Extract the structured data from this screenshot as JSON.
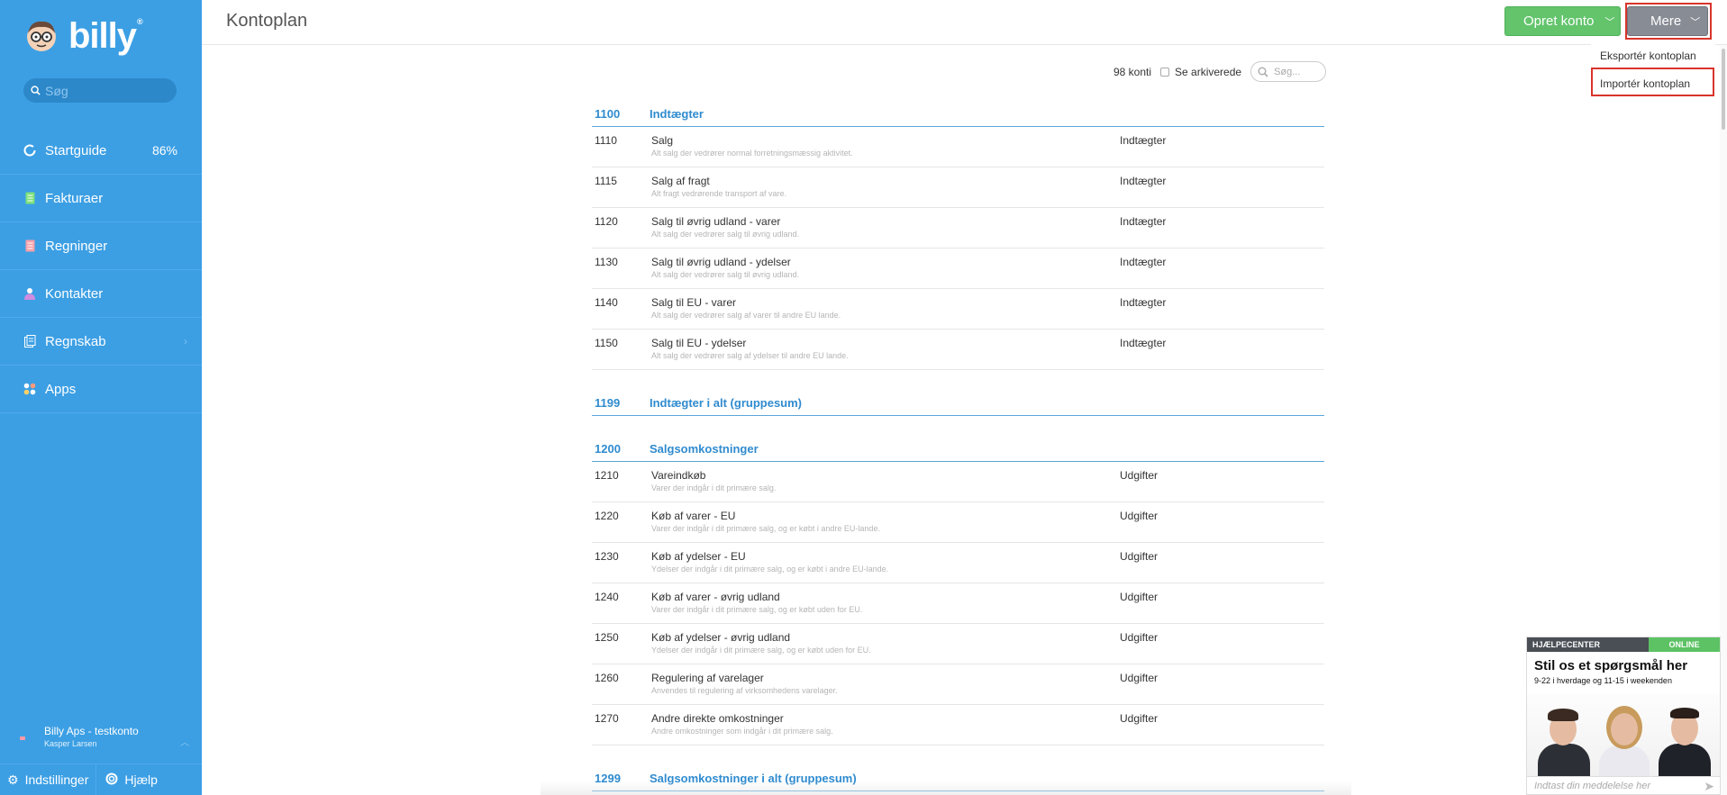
{
  "app": {
    "logo_text": "billy",
    "logo_reg": "®"
  },
  "sidebar": {
    "search_placeholder": "Søg",
    "items": [
      {
        "label": "Startguide",
        "value": "86%"
      },
      {
        "label": "Fakturaer"
      },
      {
        "label": "Regninger"
      },
      {
        "label": "Kontakter"
      },
      {
        "label": "Regnskab"
      },
      {
        "label": "Apps"
      }
    ],
    "account": {
      "name": "Billy Aps - testkonto",
      "user": "Kasper Larsen"
    },
    "bottom": {
      "settings": "Indstillinger",
      "help": "Hjælp"
    }
  },
  "header": {
    "title": "Kontoplan",
    "create_button": "Opret konto",
    "more_button": "Mere",
    "more_menu": [
      "Eksportér kontoplan",
      "Importér kontoplan"
    ]
  },
  "toolbar": {
    "count": "98 konti",
    "archived_label": "Se arkiverede",
    "search_placeholder": "Søg..."
  },
  "groups": [
    {
      "number": "1100",
      "name": "Indtægter",
      "rows": [
        {
          "number": "1110",
          "name": "Salg",
          "desc": "Alt salg der vedrører normal forretningsmæssig aktivitet.",
          "type": "Indtægter"
        },
        {
          "number": "1115",
          "name": "Salg af fragt",
          "desc": "Alt fragt vedrørende transport af vare.",
          "type": "Indtægter"
        },
        {
          "number": "1120",
          "name": "Salg til øvrig udland - varer",
          "desc": "Alt salg der vedrører salg til øvrig udland.",
          "type": "Indtægter"
        },
        {
          "number": "1130",
          "name": "Salg til øvrig udland - ydelser",
          "desc": "Alt salg der vedrører salg til øvrig udland.",
          "type": "Indtægter"
        },
        {
          "number": "1140",
          "name": "Salg til EU - varer",
          "desc": "Alt salg der vedrører salg af varer til andre EU lande.",
          "type": "Indtægter"
        },
        {
          "number": "1150",
          "name": "Salg til EU - ydelser",
          "desc": "Alt salg der vedrører salg af ydelser til andre EU lande.",
          "type": "Indtægter"
        }
      ]
    },
    {
      "number": "1199",
      "name": "Indtægter i alt (gruppesum)",
      "rows": []
    },
    {
      "number": "1200",
      "name": "Salgsomkostninger",
      "rows": [
        {
          "number": "1210",
          "name": "Vareindkøb",
          "desc": "Varer der indgår i dit primære salg.",
          "type": "Udgifter"
        },
        {
          "number": "1220",
          "name": "Køb af varer - EU",
          "desc": "Varer der indgår i dit primære salg, og er købt i andre EU-lande.",
          "type": "Udgifter"
        },
        {
          "number": "1230",
          "name": "Køb af ydelser - EU",
          "desc": "Ydelser der indgår i dit primære salg, og er købt i andre EU-lande.",
          "type": "Udgifter"
        },
        {
          "number": "1240",
          "name": "Køb af varer - øvrig udland",
          "desc": "Varer der indgår i dit primære salg, og er købt uden for EU.",
          "type": "Udgifter"
        },
        {
          "number": "1250",
          "name": "Køb af ydelser - øvrig udland",
          "desc": "Ydelser der indgår i dit primære salg, og er købt uden for EU.",
          "type": "Udgifter"
        },
        {
          "number": "1260",
          "name": "Regulering af varelager",
          "desc": "Anvendes til regulering af virksomhedens varelager.",
          "type": "Udgifter"
        },
        {
          "number": "1270",
          "name": "Andre direkte omkostninger",
          "desc": "Andre omkostninger som indgår i dit primære salg.",
          "type": "Udgifter"
        }
      ]
    },
    {
      "number": "1299",
      "name": "Salgsomkostninger i alt (gruppesum)",
      "rows": []
    }
  ],
  "help_widget": {
    "label": "HJÆLPECENTER",
    "status": "ONLINE",
    "title": "Stil os et spørgsmål her",
    "subtitle": "9-22 i hverdage og 11-15 i weekenden",
    "input_placeholder": "Indtast din meddelelse her"
  },
  "colors": {
    "sidebar": "#3c9fe4",
    "accent_blue": "#2f8bcf",
    "create_green": "#63c46c",
    "more_gray": "#888c95",
    "highlight_red": "#d9342b"
  }
}
